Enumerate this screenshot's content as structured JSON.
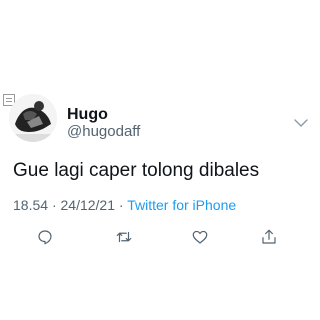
{
  "author": {
    "display_name": "Hugo",
    "handle": "@hugodaff"
  },
  "tweet": {
    "text": "Gue lagi caper tolong dibales",
    "time": "18.54",
    "date": "24/12/21",
    "separator": "·",
    "source": "Twitter for iPhone"
  },
  "icons": {
    "reply": "reply-icon",
    "retweet": "retweet-icon",
    "like": "heart-icon",
    "share": "share-icon",
    "more": "chevron-down-icon"
  },
  "colors": {
    "text": "#0f1419",
    "secondary": "#536471",
    "link": "#1d9bf0"
  }
}
